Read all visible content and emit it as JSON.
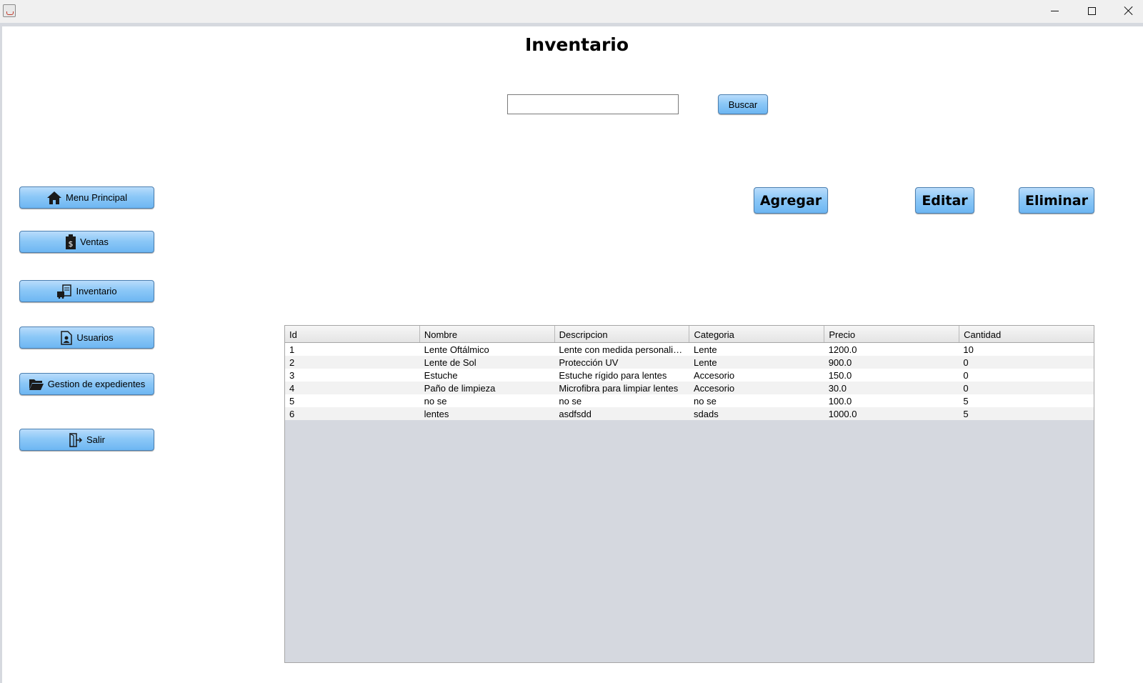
{
  "titlebar": {
    "icon": "java-cup-icon",
    "controls": [
      "minimize-icon",
      "maximize-icon",
      "close-icon"
    ]
  },
  "page": {
    "title": "Inventario"
  },
  "search": {
    "value": "",
    "button_label": "Buscar"
  },
  "actions": {
    "add_label": "Agregar",
    "edit_label": "Editar",
    "delete_label": "Eliminar"
  },
  "sidebar": {
    "items": [
      {
        "label": "Menu Principal",
        "icon": "home-icon"
      },
      {
        "label": "Ventas",
        "icon": "sales-receipt-icon"
      },
      {
        "label": "Inventario",
        "icon": "inventory-icon"
      },
      {
        "label": "Usuarios",
        "icon": "users-icon"
      },
      {
        "label": "Gestion de expedientes",
        "icon": "folder-icon"
      },
      {
        "label": "Salir",
        "icon": "exit-icon"
      }
    ]
  },
  "table": {
    "columns": [
      "Id",
      "Nombre",
      "Descripcion",
      "Categoria",
      "Precio",
      "Cantidad"
    ],
    "rows": [
      [
        "1",
        "Lente Oftálmico",
        "Lente con medida personaliza...",
        "Lente",
        "1200.0",
        "10"
      ],
      [
        "2",
        "Lente de Sol",
        "Protección UV",
        "Lente",
        "900.0",
        "0"
      ],
      [
        "3",
        "Estuche",
        "Estuche rígido para lentes",
        "Accesorio",
        "150.0",
        "0"
      ],
      [
        "4",
        "Paño de limpieza",
        "Microfibra para limpiar lentes",
        "Accesorio",
        "30.0",
        "0"
      ],
      [
        "5",
        "no se",
        "no se",
        "no se",
        "100.0",
        "5"
      ],
      [
        "6",
        "lentes",
        "asdfsdd",
        "sdads",
        "1000.0",
        "5"
      ]
    ]
  },
  "colors": {
    "button_gradient_top": "#b9dcfb",
    "button_gradient_bottom": "#6db6f2",
    "button_border": "#4b7fb0",
    "table_empty_area": "#d5d8df"
  }
}
